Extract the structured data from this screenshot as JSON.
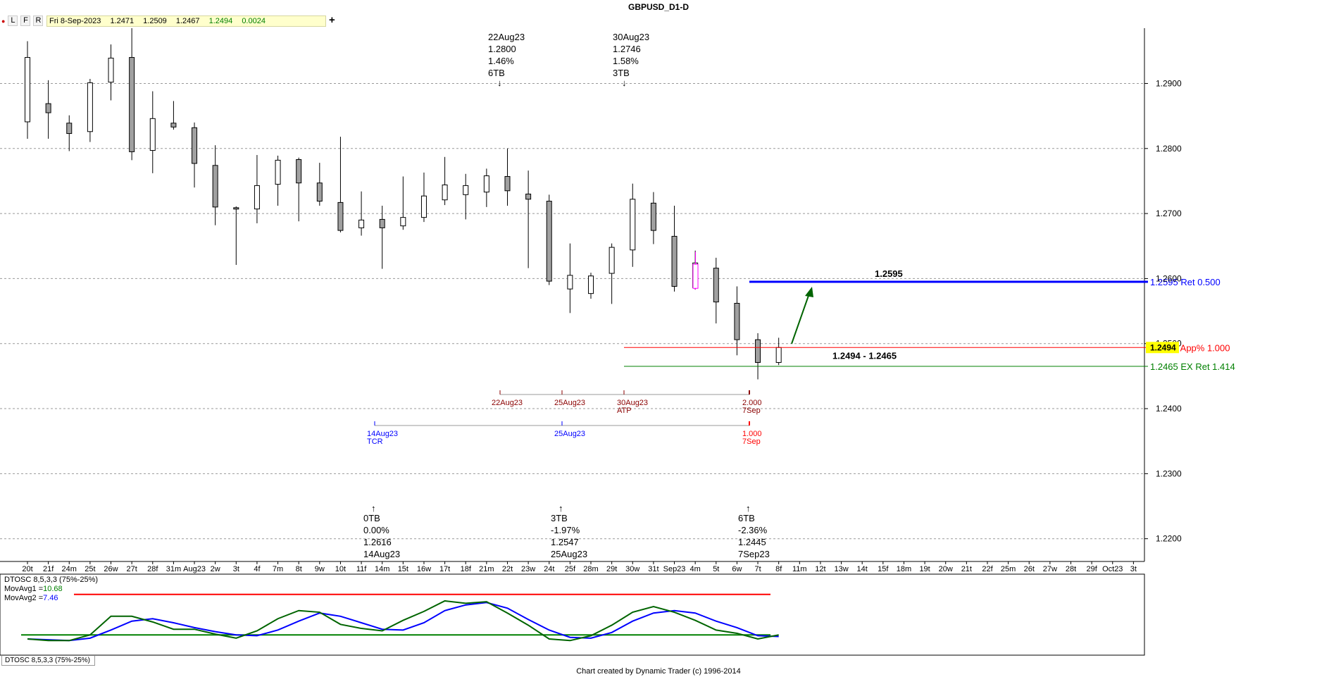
{
  "window": {
    "title": "GBPUSD_D1-D"
  },
  "toolbar": {
    "buttons": [
      "L",
      "F",
      "R"
    ],
    "add_label": "+"
  },
  "quote": {
    "date": "Fri 8-Sep-2023",
    "open": "1.2471",
    "high": "1.2509",
    "low": "1.2467",
    "close": "1.2494",
    "change": "0.0024"
  },
  "price_axis": {
    "ticks": [
      "1.2900",
      "1.2800",
      "1.2700",
      "1.2600",
      "1.2500",
      "1.2400",
      "1.2300",
      "1.2200"
    ],
    "current": "1.2494"
  },
  "date_axis": {
    "labels": [
      "20t",
      "21f",
      "24m",
      "25t",
      "26w",
      "27t",
      "28f",
      "31m",
      "Aug23",
      "2w",
      "3t",
      "4f",
      "7m",
      "8t",
      "9w",
      "10t",
      "11f",
      "14m",
      "15t",
      "16w",
      "17t",
      "18f",
      "21m",
      "22t",
      "23w",
      "24t",
      "25f",
      "28m",
      "29t",
      "30w",
      "31t",
      "Sep23",
      "4m",
      "5t",
      "6w",
      "7t",
      "8f",
      "11m",
      "12t",
      "13w",
      "14t",
      "15f",
      "18m",
      "19t",
      "20w",
      "21t",
      "22f",
      "25m",
      "26t",
      "27w",
      "28t",
      "29f",
      "Oct23",
      "3t"
    ]
  },
  "top_annotations": [
    {
      "lines": [
        "22Aug23",
        "1.2800",
        "1.46%",
        "6TB"
      ],
      "arrow": "↓"
    },
    {
      "lines": [
        "30Aug23",
        "1.2746",
        "1.58%",
        "3TB"
      ],
      "arrow": "↓"
    }
  ],
  "bottom_annotations": [
    {
      "arrow": "↑",
      "lines": [
        "0TB",
        "0.00%",
        "1.2616",
        "14Aug23"
      ]
    },
    {
      "arrow": "↑",
      "lines": [
        "3TB",
        "-1.97%",
        "1.2547",
        "25Aug23"
      ]
    },
    {
      "arrow": "↑",
      "lines": [
        "6TB",
        "-2.36%",
        "1.2445",
        "7Sep23"
      ]
    }
  ],
  "levels": [
    {
      "label": "1.2595 Ret 0.500",
      "value": 1.2595,
      "color": "#0000ff"
    },
    {
      "label": "1.2494 App% 1.000",
      "value": 1.2494,
      "color": "#ff0000"
    },
    {
      "label": "1.2465 EX Ret 1.414",
      "value": 1.2465,
      "color": "#008000"
    }
  ],
  "level_text": {
    "upper": "1.2595",
    "zone": "1.2494 - 1.2465"
  },
  "time_projections": {
    "row1": {
      "dates": [
        "22Aug23",
        "25Aug23",
        "30Aug23"
      ],
      "atp": "ATP",
      "ratio": "2.000",
      "end": "7Sep"
    },
    "row2": {
      "start": "14Aug23",
      "tcr": "TCR",
      "mid": "25Aug23",
      "ratio": "1.000",
      "end": "7Sep"
    }
  },
  "oscillator": {
    "title": "DTOSC 8,5,3,3 (75%-25%)",
    "ma1_label": "MovAvg1 =",
    "ma1_value": "10.68",
    "ma2_label": "MovAvg2 =",
    "ma2_value": "7.46",
    "tab": "DTOSC 8,5,3,3 (75%-25%)",
    "upper": 75,
    "lower": 25
  },
  "footer": "Chart created by Dynamic Trader  (c) 1996-2014",
  "chart_data": {
    "type": "candlestick",
    "title": "GBPUSD_D1-D",
    "ylim": [
      1.2165,
      1.2985
    ],
    "candles": [
      {
        "o": 1.2841,
        "h": 1.2965,
        "l": 1.2815,
        "c": 1.294
      },
      {
        "o": 1.2869,
        "h": 1.2905,
        "l": 1.2815,
        "c": 1.2855
      },
      {
        "o": 1.2839,
        "h": 1.2851,
        "l": 1.2796,
        "c": 1.2823
      },
      {
        "o": 1.2826,
        "h": 1.2907,
        "l": 1.281,
        "c": 1.2901
      },
      {
        "o": 1.2902,
        "h": 1.296,
        "l": 1.2874,
        "c": 1.2939
      },
      {
        "o": 1.294,
        "h": 1.2985,
        "l": 1.2782,
        "c": 1.2795
      },
      {
        "o": 1.2797,
        "h": 1.2888,
        "l": 1.2762,
        "c": 1.2846
      },
      {
        "o": 1.2839,
        "h": 1.2873,
        "l": 1.2829,
        "c": 1.2833
      },
      {
        "o": 1.2832,
        "h": 1.284,
        "l": 1.274,
        "c": 1.2777
      },
      {
        "o": 1.2774,
        "h": 1.2805,
        "l": 1.2682,
        "c": 1.271
      },
      {
        "o": 1.2709,
        "h": 1.2711,
        "l": 1.2621,
        "c": 1.2708
      },
      {
        "o": 1.2707,
        "h": 1.279,
        "l": 1.2685,
        "c": 1.2743
      },
      {
        "o": 1.2745,
        "h": 1.2789,
        "l": 1.2712,
        "c": 1.2782
      },
      {
        "o": 1.2783,
        "h": 1.2786,
        "l": 1.2688,
        "c": 1.2747
      },
      {
        "o": 1.2747,
        "h": 1.2778,
        "l": 1.2712,
        "c": 1.2719
      },
      {
        "o": 1.2717,
        "h": 1.2818,
        "l": 1.2671,
        "c": 1.2674
      },
      {
        "o": 1.2678,
        "h": 1.2734,
        "l": 1.2666,
        "c": 1.269
      },
      {
        "o": 1.2691,
        "h": 1.2712,
        "l": 1.2615,
        "c": 1.2678
      },
      {
        "o": 1.2681,
        "h": 1.2757,
        "l": 1.2675,
        "c": 1.2694
      },
      {
        "o": 1.2694,
        "h": 1.2763,
        "l": 1.2687,
        "c": 1.2727
      },
      {
        "o": 1.2721,
        "h": 1.2787,
        "l": 1.2713,
        "c": 1.2744
      },
      {
        "o": 1.2729,
        "h": 1.2761,
        "l": 1.2691,
        "c": 1.2743
      },
      {
        "o": 1.2733,
        "h": 1.2769,
        "l": 1.271,
        "c": 1.2758
      },
      {
        "o": 1.2757,
        "h": 1.28,
        "l": 1.2712,
        "c": 1.2735
      },
      {
        "o": 1.273,
        "h": 1.2766,
        "l": 1.2616,
        "c": 1.2722
      },
      {
        "o": 1.2719,
        "h": 1.2729,
        "l": 1.259,
        "c": 1.2596
      },
      {
        "o": 1.2584,
        "h": 1.2654,
        "l": 1.2547,
        "c": 1.2605
      },
      {
        "o": 1.2577,
        "h": 1.2609,
        "l": 1.2569,
        "c": 1.2604
      },
      {
        "o": 1.2608,
        "h": 1.2654,
        "l": 1.2561,
        "c": 1.2648
      },
      {
        "o": 1.2644,
        "h": 1.2746,
        "l": 1.2618,
        "c": 1.2722
      },
      {
        "o": 1.2716,
        "h": 1.2733,
        "l": 1.2653,
        "c": 1.2674
      },
      {
        "o": 1.2665,
        "h": 1.2712,
        "l": 1.258,
        "c": 1.2588
      },
      {
        "o": 1.2586,
        "h": 1.2643,
        "l": 1.2583,
        "c": 1.2624
      },
      {
        "o": 1.2616,
        "h": 1.2632,
        "l": 1.2531,
        "c": 1.2564
      },
      {
        "o": 1.2562,
        "h": 1.2588,
        "l": 1.2482,
        "c": 1.2506
      },
      {
        "o": 1.2506,
        "h": 1.2516,
        "l": 1.2445,
        "c": 1.2471
      },
      {
        "o": 1.2471,
        "h": 1.2509,
        "l": 1.2467,
        "c": 1.2494
      }
    ],
    "osc_fast": [
      20,
      18,
      18,
      25,
      48,
      48,
      41,
      32,
      32,
      26,
      21,
      30,
      45,
      55,
      53,
      38,
      33,
      30,
      43,
      54,
      67,
      64,
      66,
      52,
      37,
      20,
      18,
      24,
      37,
      53,
      60,
      53,
      43,
      31,
      27,
      20,
      25
    ],
    "osc_slow": [
      20,
      19,
      18,
      21,
      31,
      42,
      45,
      40,
      34,
      29,
      25,
      24,
      31,
      42,
      52,
      48,
      40,
      32,
      31,
      40,
      55,
      62,
      65,
      58,
      44,
      31,
      22,
      21,
      28,
      42,
      52,
      55,
      52,
      42,
      34,
      24,
      23
    ]
  }
}
